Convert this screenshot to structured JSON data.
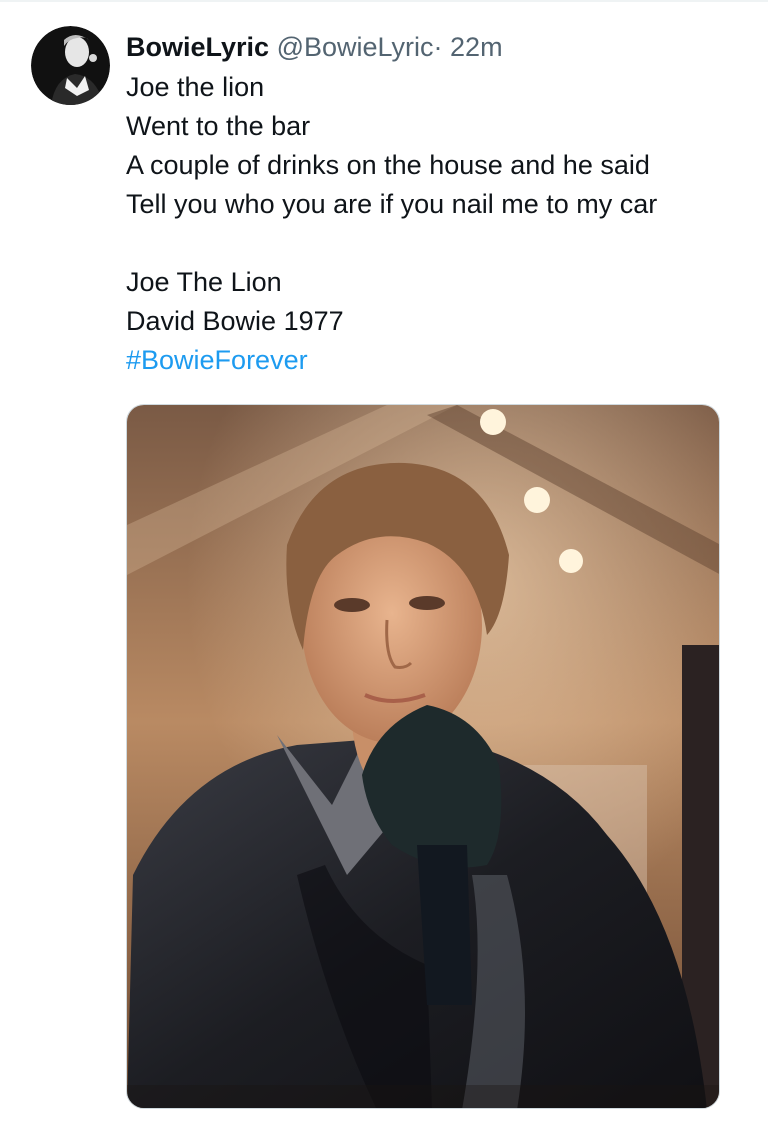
{
  "tweet": {
    "display_name": "BowieLyric",
    "handle": "@BowieLyric",
    "separator": "·",
    "time": "22m",
    "lines": [
      "Joe the lion",
      "Went to the bar",
      "A couple of drinks on the house and he said",
      "Tell you who you are if you nail me to my car",
      "",
      "Joe The Lion",
      "David Bowie 1977"
    ],
    "hashtag": "#BowieForever"
  },
  "colors": {
    "text": "#0f1419",
    "secondary": "#536471",
    "link": "#1d9bf0"
  }
}
